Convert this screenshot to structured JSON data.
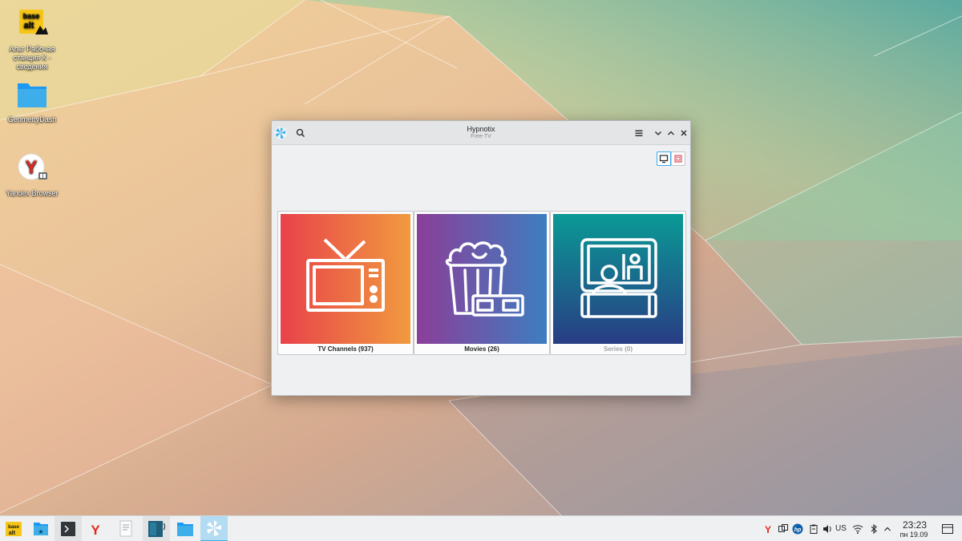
{
  "desktop": {
    "icons": [
      {
        "label": "Альт Рабочая станция К - сведения",
        "icon": "basealt-logo"
      },
      {
        "label": "GeometryDash",
        "icon": "folder-icon"
      },
      {
        "label": "Yandex Browser",
        "icon": "yandex-browser-icon"
      }
    ],
    "logo_text_top": "base",
    "logo_text_bottom": "alt"
  },
  "window": {
    "title": "Hypnotix",
    "subtitle": "Free-TV",
    "cards": [
      {
        "label": "TV Channels (937)",
        "icon": "tv-icon",
        "gradient": [
          "#e8424a",
          "#f19a3f"
        ],
        "enabled": true
      },
      {
        "label": "Movies (26)",
        "icon": "popcorn-3d-glasses-icon",
        "gradient": [
          "#8b3e99",
          "#3d7ec0"
        ],
        "enabled": true
      },
      {
        "label": "Series (0)",
        "icon": "theater-screen-icon",
        "gradient": [
          "#0a9a95",
          "#283d84"
        ],
        "enabled": false
      }
    ]
  },
  "taskbar": {
    "tray": {
      "keyboard_layout": "US",
      "time": "23:23",
      "date": "пн 19.09"
    }
  },
  "colors": {
    "accent": "#3daee9",
    "window_bg": "#eff0f1"
  }
}
